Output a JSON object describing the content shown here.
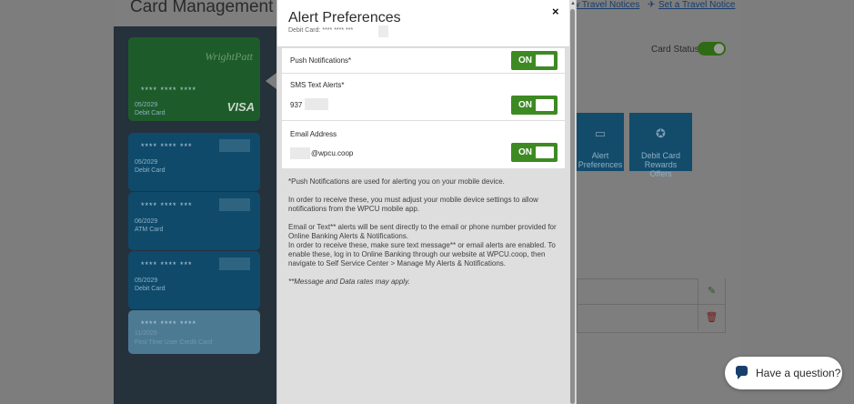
{
  "background": {
    "page_title": "Card Management",
    "links": {
      "view_travel_notices": "w Travel Notices",
      "set_travel_notice": "Set a Travel Notice"
    },
    "card_status_label": "Card Status",
    "tiles": [
      {
        "label": "Alert\nPreferences",
        "icon": "bell-icon"
      },
      {
        "label": "Debit Card\nRewards\nOffers",
        "icon": "award-icon"
      }
    ],
    "cards": [
      {
        "number": "**** **** ****",
        "expiry": "05/2029",
        "type": "Debit Card",
        "logo": "WrightPatt",
        "network": "VISA"
      },
      {
        "number": "**** **** ***",
        "expiry": "05/2029",
        "type": "Debit Card"
      },
      {
        "number": "**** **** ***",
        "expiry": "06/2029",
        "type": "ATM Card"
      },
      {
        "number": "**** **** ***",
        "expiry": "05/2029",
        "type": "Debit Card"
      },
      {
        "number": "**** **** ****",
        "expiry": "11/2029",
        "type": "First Time User Credit Card"
      }
    ]
  },
  "modal": {
    "title": "Alert Preferences",
    "subtitle": "Debit Card: **** **** ***",
    "close_label": "×",
    "rows": [
      {
        "label": "Push Notifications*",
        "value": "",
        "toggle": "ON"
      },
      {
        "label": "SMS Text Alerts*",
        "value": "937",
        "toggle": "ON"
      },
      {
        "label": "Email Address",
        "value": "@wpcu.coop",
        "toggle": "ON"
      }
    ],
    "notes": [
      "*Push Notifications are used for alerting you on your mobile device.",
      "In order to receive these, you must adjust your mobile device settings to allow notifications from the WPCU mobile app.",
      "Email or Text** alerts will be sent directly to the email or phone number provided for Online Banking Alerts & Notifications.",
      "In order to receive these, make sure text message** or email alerts are enabled. To enable these, log in to Online Banking through our website at WPCU.coop, then navigate to Self Service Center > Manage My Alerts & Notifications.",
      "**Message and Data rates may apply."
    ]
  },
  "chat": {
    "label": "Have a question?",
    "icon": "chat-bubble-icon"
  },
  "colors": {
    "toggle_on": "#3d8a23",
    "brand_navy": "#173f6e",
    "tile_blue": "#134b6b"
  }
}
